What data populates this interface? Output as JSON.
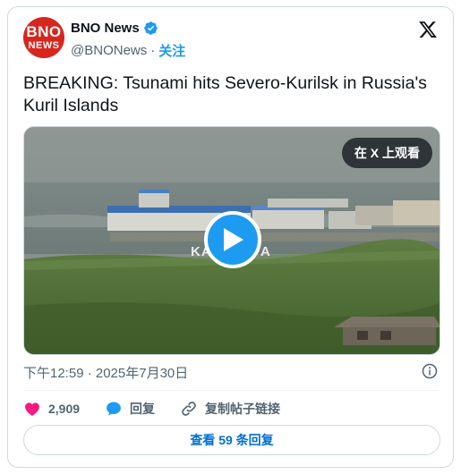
{
  "author": {
    "avatar_top": "BNO",
    "avatar_bottom": "NEWS",
    "display_name": "BNO News",
    "handle": "@BNONews",
    "separator": "·",
    "follow_label": "关注"
  },
  "tweet": {
    "text": "BREAKING: Tsunami hits Severo-Kurilsk in Russia's Kuril Islands"
  },
  "media": {
    "watch_label": "在 X 上观看",
    "overlay_left": "KA",
    "overlay_right": "A"
  },
  "meta": {
    "timestamp": "下午12:59 · 2025年7月30日"
  },
  "actions": {
    "likes": "2,909",
    "reply_label": "回复",
    "copy_link_label": "复制帖子链接"
  },
  "footer": {
    "replies_label": "查看 59 条回复"
  },
  "colors": {
    "brand_red": "#d7261e",
    "x_blue": "#1d9bf0",
    "like_pink": "#f91880",
    "link_blue": "#006fd6",
    "muted_text": "#536471"
  },
  "icons": {
    "verified": "verified-badge-icon",
    "x": "x-logo-icon",
    "info": "info-icon",
    "like": "heart-icon",
    "reply": "speech-bubble-icon",
    "copy_link": "link-icon",
    "play": "play-icon"
  }
}
